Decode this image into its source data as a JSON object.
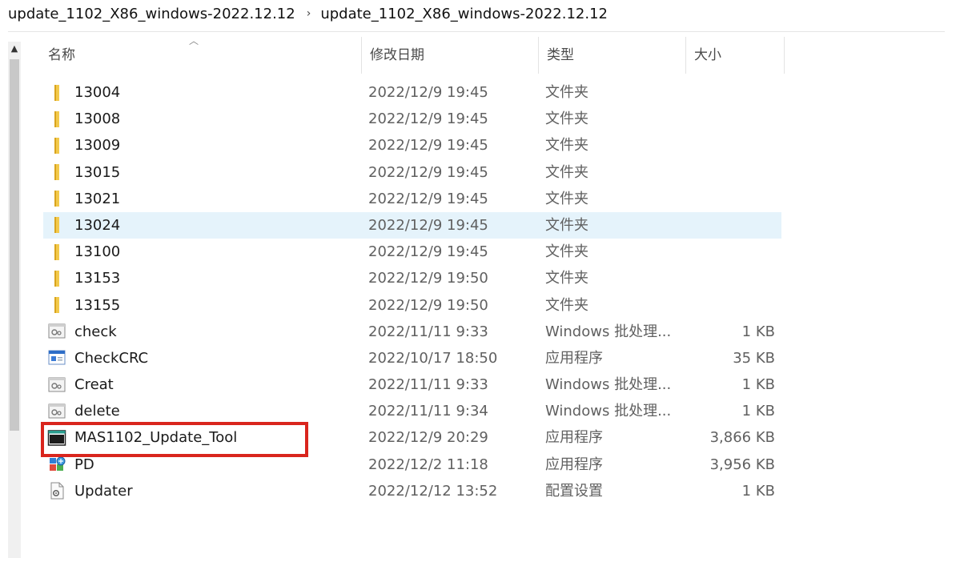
{
  "breadcrumb": {
    "items": [
      "update_1102_X86_windows-2022.12.12",
      "update_1102_X86_windows-2022.12.12"
    ],
    "separator": "›"
  },
  "columns": {
    "name": "名称",
    "date": "修改日期",
    "type": "类型",
    "size": "大小"
  },
  "files": [
    {
      "name": "13004",
      "date": "2022/12/9 19:45",
      "type": "文件夹",
      "size": "",
      "icon": "folder-icon",
      "selected": false
    },
    {
      "name": "13008",
      "date": "2022/12/9 19:45",
      "type": "文件夹",
      "size": "",
      "icon": "folder-icon",
      "selected": false
    },
    {
      "name": "13009",
      "date": "2022/12/9 19:45",
      "type": "文件夹",
      "size": "",
      "icon": "folder-icon",
      "selected": false
    },
    {
      "name": "13015",
      "date": "2022/12/9 19:45",
      "type": "文件夹",
      "size": "",
      "icon": "folder-icon",
      "selected": false
    },
    {
      "name": "13021",
      "date": "2022/12/9 19:45",
      "type": "文件夹",
      "size": "",
      "icon": "folder-icon",
      "selected": false
    },
    {
      "name": "13024",
      "date": "2022/12/9 19:45",
      "type": "文件夹",
      "size": "",
      "icon": "folder-icon",
      "selected": true
    },
    {
      "name": "13100",
      "date": "2022/12/9 19:45",
      "type": "文件夹",
      "size": "",
      "icon": "folder-icon",
      "selected": false
    },
    {
      "name": "13153",
      "date": "2022/12/9 19:50",
      "type": "文件夹",
      "size": "",
      "icon": "folder-icon",
      "selected": false
    },
    {
      "name": "13155",
      "date": "2022/12/9 19:50",
      "type": "文件夹",
      "size": "",
      "icon": "folder-icon",
      "selected": false
    },
    {
      "name": "check",
      "date": "2022/11/11 9:33",
      "type": "Windows 批处理...",
      "size": "1 KB",
      "icon": "batch-file-icon",
      "selected": false
    },
    {
      "name": "CheckCRC",
      "date": "2022/10/17 18:50",
      "type": "应用程序",
      "size": "35 KB",
      "icon": "application-icon",
      "selected": false
    },
    {
      "name": "Creat",
      "date": "2022/11/11 9:33",
      "type": "Windows 批处理...",
      "size": "1 KB",
      "icon": "batch-file-icon",
      "selected": false
    },
    {
      "name": "delete",
      "date": "2022/11/11 9:34",
      "type": "Windows 批处理...",
      "size": "1 KB",
      "icon": "batch-file-icon",
      "selected": false
    },
    {
      "name": "MAS1102_Update_Tool",
      "date": "2022/12/9 20:29",
      "type": "应用程序",
      "size": "3,866 KB",
      "icon": "app-window-icon",
      "selected": false
    },
    {
      "name": "PD",
      "date": "2022/12/2 11:18",
      "type": "应用程序",
      "size": "3,956 KB",
      "icon": "installer-icon",
      "selected": false
    },
    {
      "name": "Updater",
      "date": "2022/12/12 13:52",
      "type": "配置设置",
      "size": "1 KB",
      "icon": "config-file-icon",
      "selected": false
    }
  ],
  "highlight": {
    "target": "MAS1102_Update_Tool",
    "color": "#d9251d"
  },
  "colors": {
    "selection": "#e5f3fb",
    "folder": "#f2c94c",
    "secondary_text": "#606060"
  }
}
